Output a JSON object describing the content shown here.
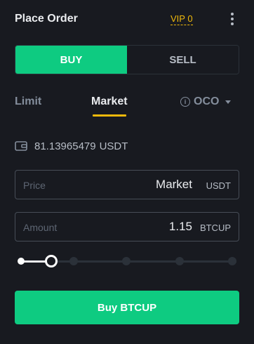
{
  "header": {
    "title": "Place Order",
    "vip_label": "VIP 0"
  },
  "side_toggle": {
    "buy_label": "BUY",
    "sell_label": "SELL",
    "selected": "BUY"
  },
  "order_tabs": {
    "limit_label": "Limit",
    "market_label": "Market",
    "oco_label": "OCO",
    "selected": "Market"
  },
  "balance": {
    "value": "81.13965479",
    "unit": "USDT"
  },
  "price_field": {
    "label": "Price",
    "value": "Market",
    "unit": "USDT"
  },
  "amount_field": {
    "label": "Amount",
    "value": "1.15",
    "unit": "BTCUP"
  },
  "slider": {
    "percent": 0.14
  },
  "submit": {
    "label": "Buy BTCUP"
  },
  "colors": {
    "background": "#181a20",
    "buy_green": "#0ecb81",
    "accent_yellow": "#f0b90b",
    "muted_text": "#848e9c"
  }
}
